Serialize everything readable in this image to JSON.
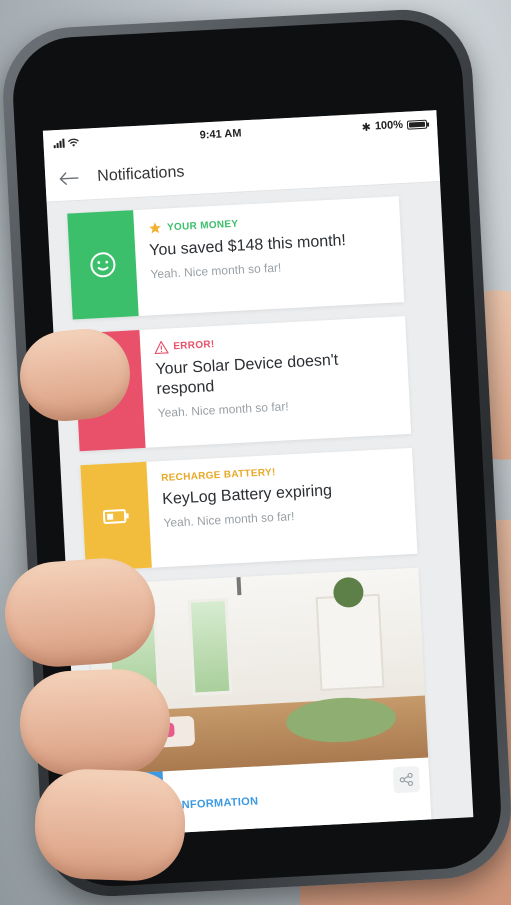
{
  "status_bar": {
    "time": "9:41 AM",
    "battery": "100%"
  },
  "nav": {
    "title": "Notifications",
    "back_icon": "arrow-left-icon"
  },
  "notifications": [
    {
      "category": "YOUR MONEY",
      "category_icon": "star-icon",
      "title": "You saved $148 this month!",
      "subtitle": "Yeah. Nice month so far!",
      "stripe_icon": "smiley-icon",
      "color": "#3cbf6b"
    },
    {
      "category": "ERROR!",
      "category_icon": "warning-icon",
      "title": "Your Solar Device doesn't respond",
      "subtitle": "Yeah. Nice month so far!",
      "stripe_icon": "no-wifi-icon",
      "color": "#e9506a"
    },
    {
      "category": "RECHARGE BATTERY!",
      "title": "KeyLog Battery expiring",
      "subtitle": "Yeah. Nice month so far!",
      "stripe_icon": "battery-icon",
      "color": "#f2bd3c"
    },
    {
      "category": "INFORMATION",
      "image": "living-room-photo",
      "action_icon": "share-icon",
      "color": "#3d9ae2"
    }
  ]
}
